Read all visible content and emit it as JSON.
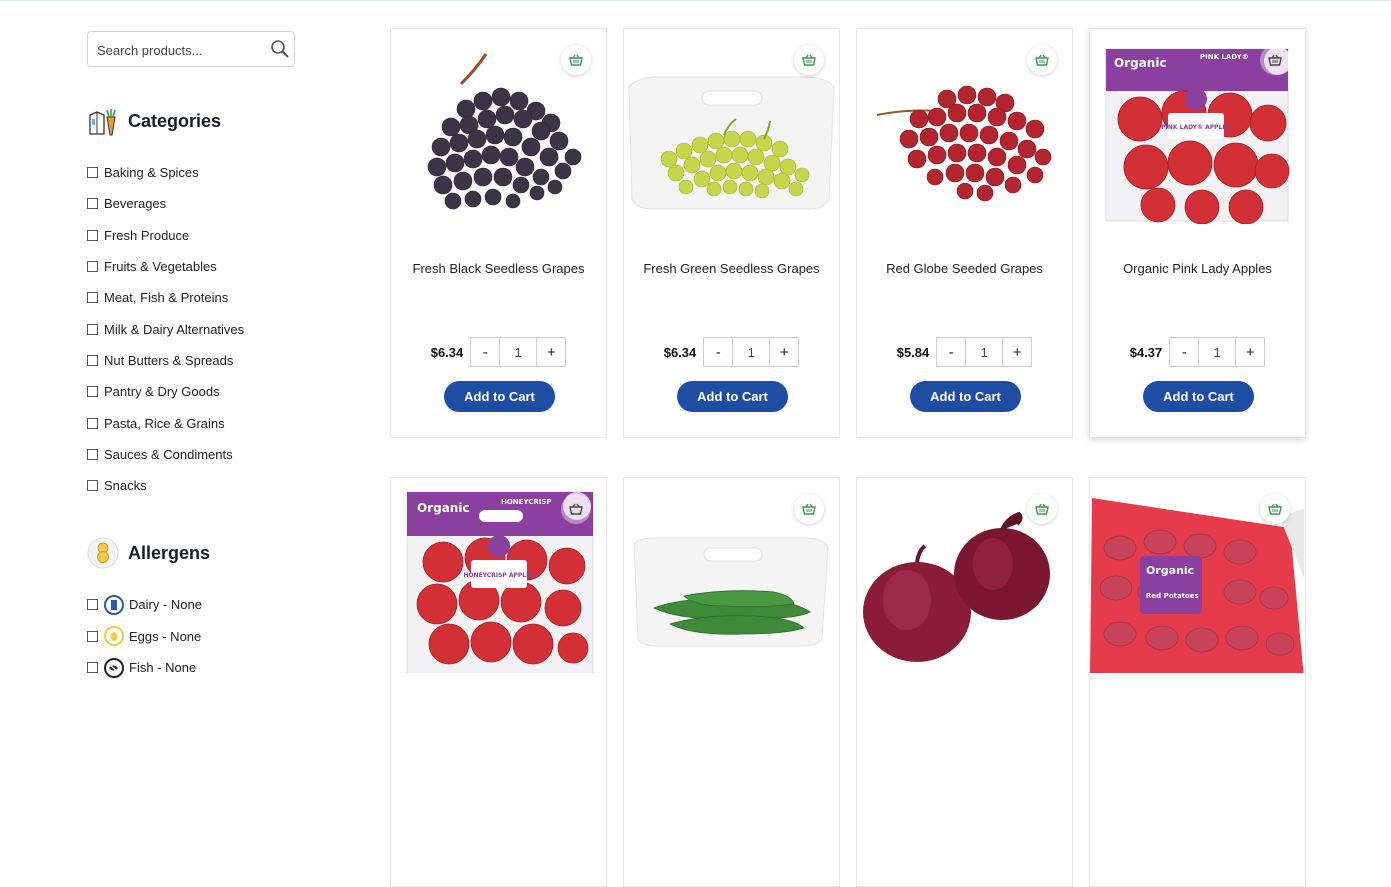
{
  "search": {
    "placeholder": "Search products..."
  },
  "categories": {
    "title": "Categories",
    "items": [
      "Baking & Spices",
      "Beverages",
      "Fresh Produce",
      "Fruits & Vegetables",
      "Meat, Fish & Proteins",
      "Milk & Dairy Alternatives",
      "Nut Butters & Spreads",
      "Pantry & Dry Goods",
      "Pasta, Rice & Grains",
      "Sauces & Condiments",
      "Snacks"
    ]
  },
  "allergens": {
    "title": "Allergens",
    "items": [
      "Dairy - None",
      "Eggs - None",
      "Fish - None"
    ]
  },
  "products": [
    {
      "name": "Fresh Black Seedless Grapes",
      "price": "$6.34",
      "qty": "1",
      "cta": "Add to Cart"
    },
    {
      "name": "Fresh Green Seedless Grapes",
      "price": "$6.34",
      "qty": "1",
      "cta": "Add to Cart"
    },
    {
      "name": "Red Globe Seeded Grapes",
      "price": "$5.84",
      "qty": "1",
      "cta": "Add to Cart"
    },
    {
      "name": "Organic Pink Lady Apples",
      "price": "$4.37",
      "qty": "1",
      "cta": "Add to Cart"
    }
  ],
  "bag_labels": {
    "organic": "Organic",
    "pink_lady": "PINK LADY®",
    "pink_lady_apples": "PINK LADY® APPLES",
    "honeycrisp": "HONEYCRISP",
    "honeycrisp_apples": "HONEYCRISP APPLES",
    "red_potatoes": "Red Potatoes"
  },
  "qty_minus": "-",
  "qty_plus": "+",
  "colors": {
    "accent": "#1d4ea4",
    "basket_green": "#3a9a4a",
    "organic_purple": "#7b3d9a"
  }
}
